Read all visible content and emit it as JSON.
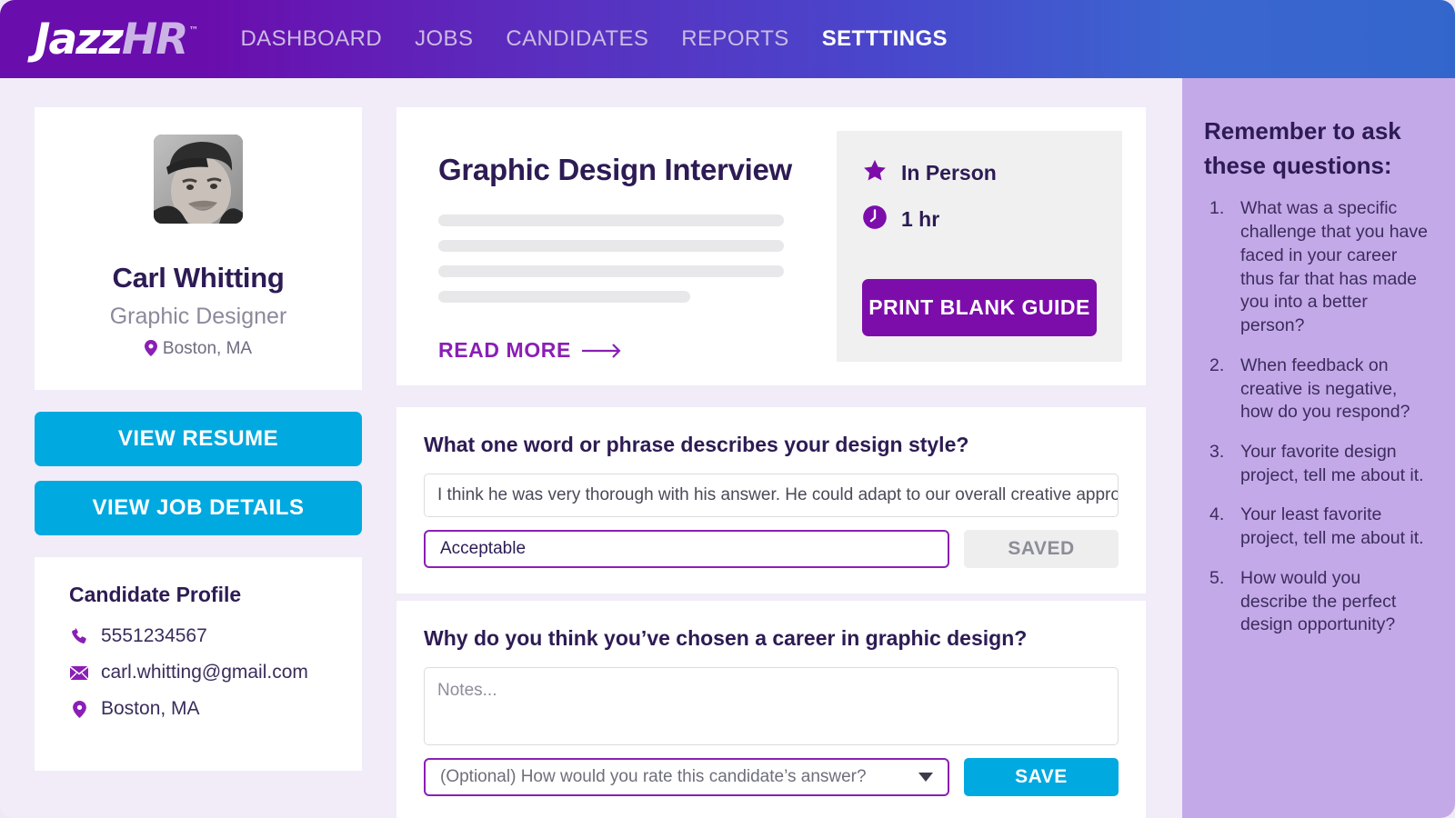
{
  "nav": {
    "logo": {
      "part1": "Jazz",
      "part2": "HR",
      "tm": "™"
    },
    "items": [
      {
        "label": "DASHBOARD",
        "active": false
      },
      {
        "label": "JOBS",
        "active": false
      },
      {
        "label": "CANDIDATES",
        "active": false
      },
      {
        "label": "REPORTS",
        "active": false
      },
      {
        "label": "SETTTINGS",
        "active": true
      }
    ]
  },
  "colors": {
    "brand_purple": "#6a0dad",
    "brand_blue": "#3366cc",
    "accent_cyan": "#00a9e0",
    "accent_violet": "#8a1fb5",
    "button_purple": "#7d0dab",
    "page_bg": "#f1ecf8",
    "right_panel_bg": "#c4a9e9",
    "text_dark": "#2d1b54"
  },
  "profile": {
    "avatar_alt": "candidate-photo",
    "name": "Carl Whitting",
    "title": "Graphic Designer",
    "location": "Boston, MA",
    "location_icon": "map-pin-icon"
  },
  "actions": {
    "view_resume": "VIEW RESUME",
    "view_job_details": "VIEW JOB DETAILS"
  },
  "contact": {
    "heading": "Candidate Profile",
    "rows": [
      {
        "icon": "phone-icon",
        "value": "5551234567"
      },
      {
        "icon": "envelope-icon",
        "value": "carl.whitting@gmail.com"
      },
      {
        "icon": "map-pin-icon",
        "value": "Boston, MA"
      }
    ]
  },
  "interview": {
    "title": "Graphic Design Interview",
    "read_more": "READ MORE",
    "read_more_icon": "arrow-right-icon",
    "meta": [
      {
        "icon": "star-icon",
        "label": "In Person"
      },
      {
        "icon": "clock-icon",
        "label": "1 hr"
      }
    ],
    "print_button": "PRINT BLANK GUIDE"
  },
  "questions": [
    {
      "prompt": "What one word or phrase describes your design style?",
      "answer": "I think he was very thorough with his answer. He could adapt to our overall creative approach based",
      "rating_value": "Acceptable",
      "rating_is_placeholder": false,
      "action_label": "SAVED",
      "action_state": "saved",
      "has_caret": false
    },
    {
      "prompt": "Why do you think you’ve chosen a career in graphic design?",
      "notes_placeholder": "Notes...",
      "rating_value": "(Optional) How would you rate this candidate’s answer?",
      "rating_is_placeholder": true,
      "action_label": "SAVE",
      "action_state": "active",
      "has_caret": true
    }
  ],
  "reminder": {
    "heading": "Remember to ask these questions:",
    "items": [
      {
        "num": "1.",
        "text": "What was a specific challenge that you have faced in your career thus far that has made you into a better person?"
      },
      {
        "num": "2.",
        "text": "When feedback on creative is negative, how do you respond?"
      },
      {
        "num": "3.",
        "text": "Your favorite design project, tell me about it."
      },
      {
        "num": "4.",
        "text": "Your least favorite project, tell me about it."
      },
      {
        "num": "5.",
        "text": "How would you describe the perfect design opportunity?"
      }
    ]
  }
}
